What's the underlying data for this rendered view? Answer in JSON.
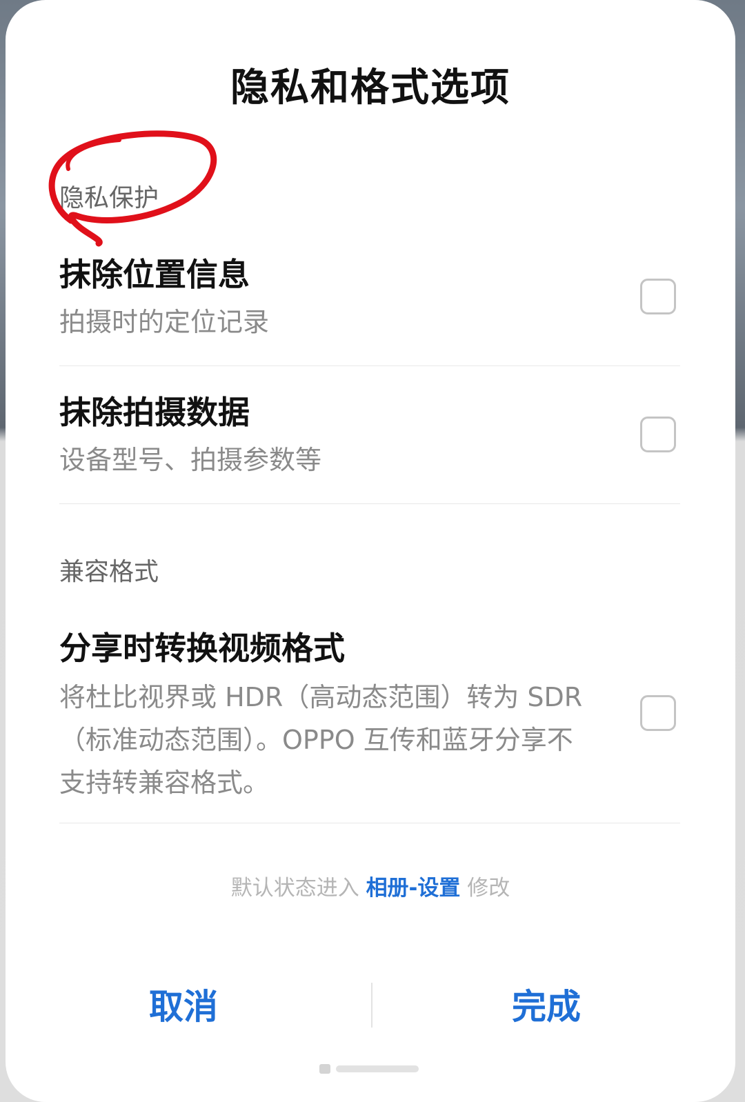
{
  "dialog": {
    "title": "隐私和格式选项"
  },
  "sections": {
    "privacy": {
      "label": "隐私保护",
      "items": [
        {
          "title": "抹除位置信息",
          "subtitle": "拍摄时的定位记录",
          "checked": false
        },
        {
          "title": "抹除拍摄数据",
          "subtitle": "设备型号、拍摄参数等",
          "checked": false
        }
      ]
    },
    "compat": {
      "label": "兼容格式",
      "items": [
        {
          "title": "分享时转换视频格式",
          "subtitle": "将杜比视界或 HDR（高动态范围）转为 SDR（标准动态范围）。OPPO 互传和蓝牙分享不支持转兼容格式。",
          "checked": false
        }
      ]
    }
  },
  "footer": {
    "prefix": "默认状态进入",
    "link": "相册-设置",
    "suffix": "修改"
  },
  "buttons": {
    "cancel": "取消",
    "done": "完成"
  },
  "colors": {
    "accent": "#1f6fd6",
    "annotation": "#e0101a"
  },
  "annotation": {
    "type": "red-hand-drawn-circle",
    "target": "隐私保护"
  }
}
